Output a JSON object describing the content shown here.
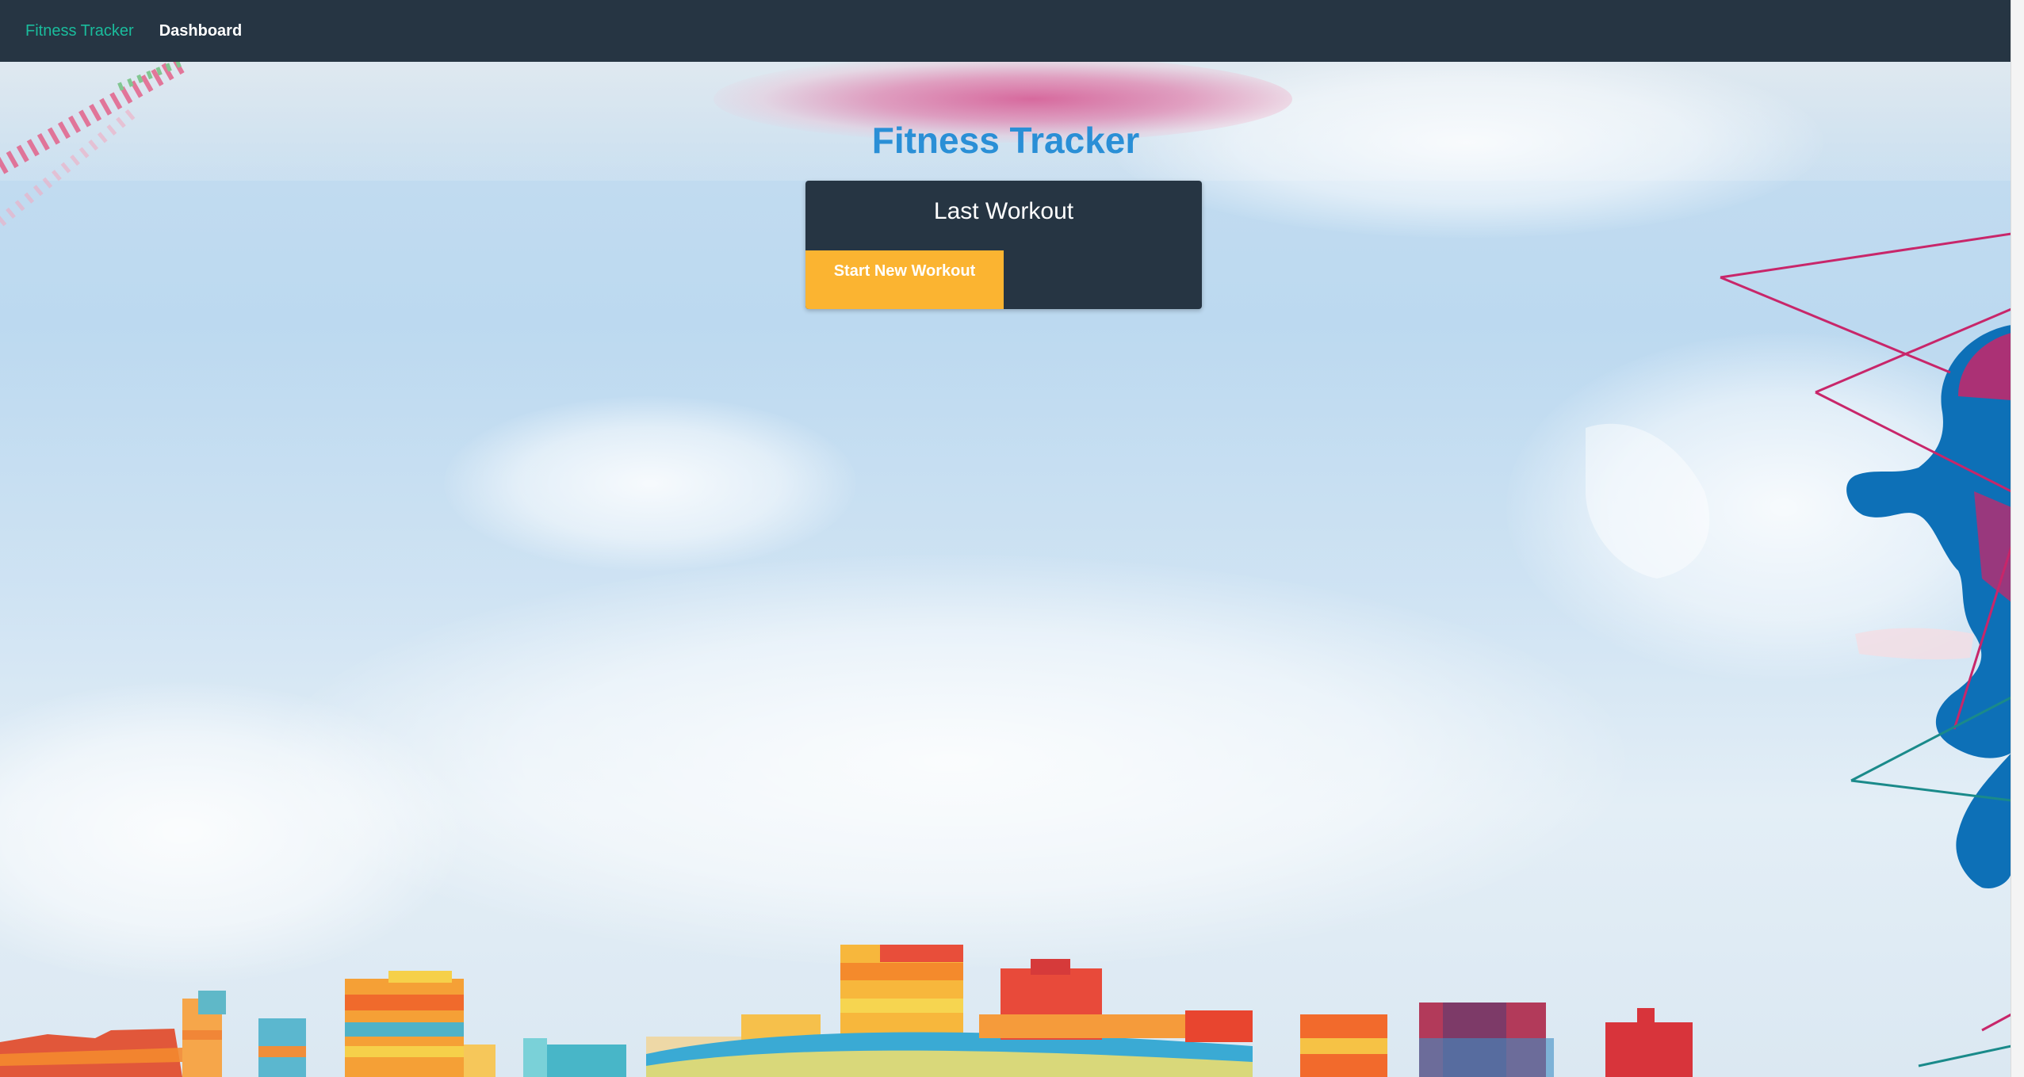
{
  "navbar": {
    "brand": "Fitness Tracker",
    "links": [
      "Dashboard"
    ]
  },
  "main": {
    "title": "Fitness Tracker",
    "card": {
      "title": "Last Workout",
      "button_label": "Start New Workout"
    }
  },
  "colors": {
    "navbar_bg": "#263543",
    "brand_text": "#1abc9c",
    "title_text": "#2a8fd6",
    "button_bg": "#fbb431"
  },
  "icons": {
    "background": "sky-clouds-skyline-runner-illustration"
  }
}
